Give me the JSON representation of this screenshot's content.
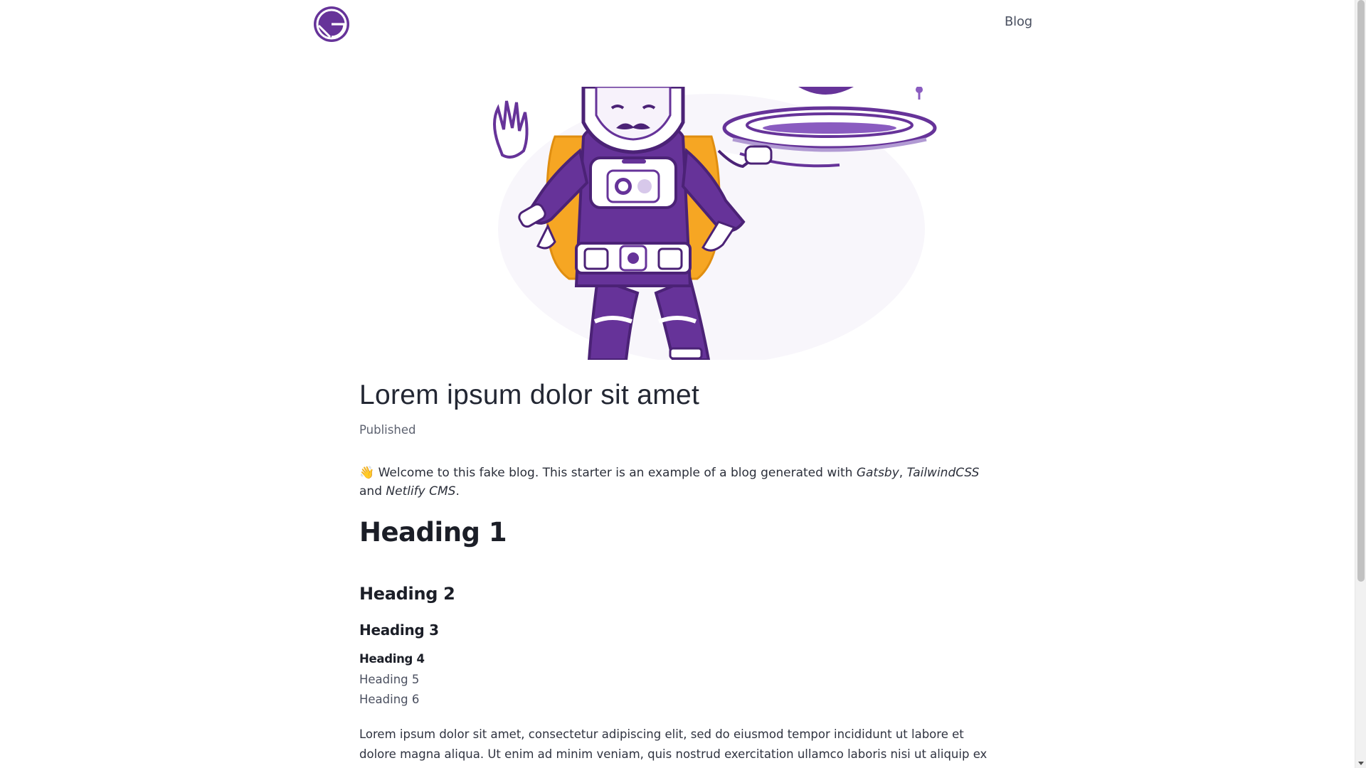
{
  "header": {
    "logo_name": "gatsby-logo",
    "nav_blog": "Blog"
  },
  "hero": {
    "alt": "Gatsby astronaut illustration"
  },
  "post": {
    "title": "Lorem ipsum dolor sit amet",
    "published": "Published",
    "intro": {
      "emoji": "👋",
      "text_before": " Welcome to this fake blog. This starter is an example of a blog generated with ",
      "gatsby": "Gatsby",
      "comma": ", ",
      "tailwind": "TailwindCSS",
      "and": " and ",
      "netlify": "Netlify CMS",
      "period": "."
    },
    "h1": "Heading 1",
    "h2": "Heading 2",
    "h3": "Heading 3",
    "h4": "Heading 4",
    "h5": "Heading 5",
    "h6": "Heading 6",
    "paragraph": "Lorem ipsum dolor sit amet, consectetur adipiscing elit, sed do eiusmod tempor incididunt ut labore et dolore magna aliqua. Ut enim ad minim veniam, quis nostrud exercitation ullamco laboris nisi ut aliquip ex ea commodo consequat. Duis aute irure dolor in reprehenderit in voluptate velit esse cillum dolore eu fugiat nulla pariatur. Excepteur sint"
  },
  "colors": {
    "brand_purple": "#663399",
    "accent_orange": "#f6a623",
    "text_dark": "#232733",
    "text_muted": "#5d6270"
  }
}
